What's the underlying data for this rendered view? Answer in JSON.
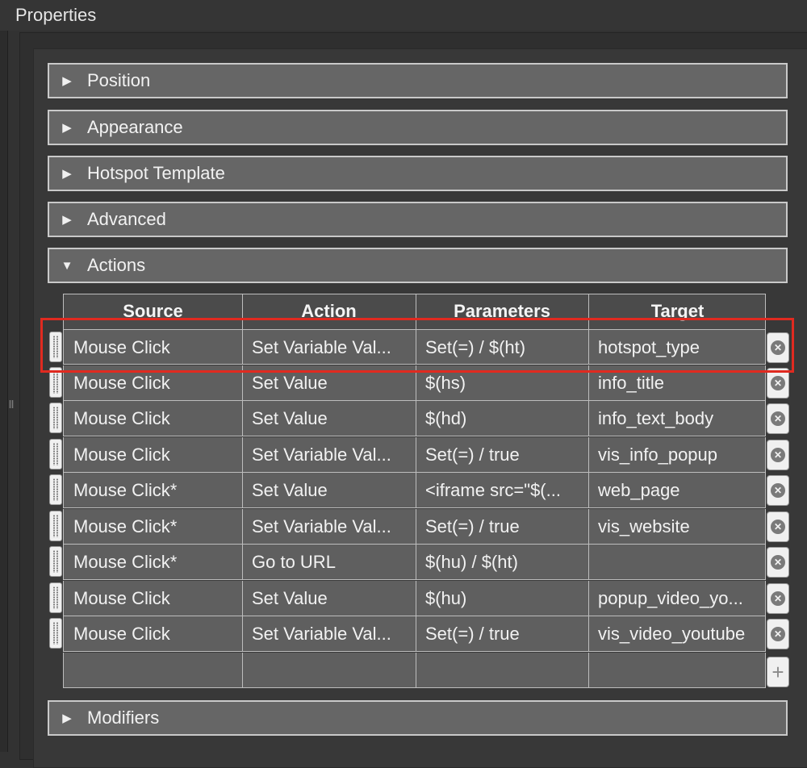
{
  "panel": {
    "title": "Properties"
  },
  "sections": [
    {
      "label": "Position",
      "expanded": false
    },
    {
      "label": "Appearance",
      "expanded": false
    },
    {
      "label": "Hotspot Template",
      "expanded": false
    },
    {
      "label": "Advanced",
      "expanded": false
    },
    {
      "label": "Actions",
      "expanded": true
    },
    {
      "label": "Modifiers",
      "expanded": false
    }
  ],
  "actions_table": {
    "columns": [
      "Source",
      "Action",
      "Parameters",
      "Target"
    ],
    "rows": [
      [
        "Mouse Click",
        "Set Variable Val...",
        "Set(=) / $(ht)",
        "hotspot_type"
      ],
      [
        "Mouse Click",
        "Set Value",
        "$(hs)",
        "info_title"
      ],
      [
        "Mouse Click",
        "Set Value",
        "$(hd)",
        "info_text_body"
      ],
      [
        "Mouse Click",
        "Set Variable Val...",
        "Set(=) / true",
        "vis_info_popup"
      ],
      [
        "Mouse Click*",
        "Set Value",
        "<iframe src=\"$(...",
        "web_page"
      ],
      [
        "Mouse Click*",
        "Set Variable Val...",
        "Set(=) / true",
        "vis_website"
      ],
      [
        "Mouse Click*",
        "Go to URL",
        "$(hu) / $(ht)",
        ""
      ],
      [
        "Mouse Click",
        "Set Value",
        "$(hu)",
        "popup_video_yo..."
      ],
      [
        "Mouse Click",
        "Set Variable Val...",
        "Set(=) / true",
        "vis_video_youtube"
      ],
      [
        "",
        "",
        "",
        ""
      ]
    ]
  },
  "icons": {
    "collapsed": "triangle-right-icon",
    "expanded": "triangle-down-icon",
    "row_handle": "drag-handle-icon",
    "row_delete": "remove-circle-icon",
    "row_add": "plus-icon"
  },
  "colors": {
    "highlight": "#e02a20"
  }
}
